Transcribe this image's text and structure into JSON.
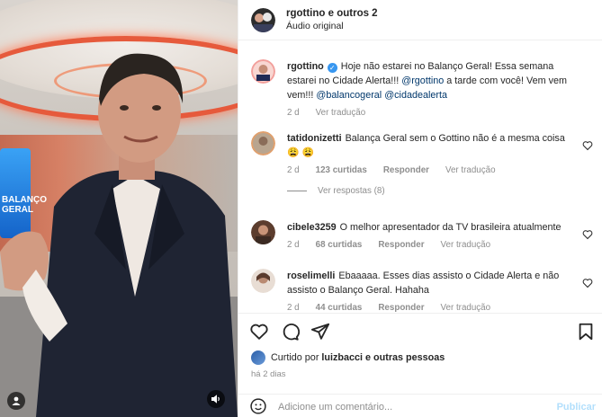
{
  "video": {
    "screen_text": "BALANÇO GERAL",
    "sound_icon": "speaker-icon",
    "user_icon": "user-tag-icon"
  },
  "header": {
    "title": "rgottino e outros 2",
    "subtitle": "Áudio original"
  },
  "comments": [
    {
      "username": "rgottino",
      "verified": true,
      "text_before": "Hoje não estarei no Balanço Geral! Essa semana estarei no Cidade Alerta!!! ",
      "mention1": "@rgottino",
      "text_mid": " a tarde com você! Vem vem vem!!! ",
      "mention2": "@balancogeral",
      "mention3": "@cidadealerta",
      "time": "2 d",
      "translate": "Ver tradução"
    },
    {
      "username": "tatidonizetti",
      "text": "Balança Geral sem o Gottino não é a mesma coisa",
      "emoji": "😩 😩",
      "time": "2 d",
      "likes": "123 curtidas",
      "reply": "Responder",
      "translate": "Ver tradução",
      "view_replies": "Ver respostas (8)"
    },
    {
      "username": "cibele3259",
      "text": "O melhor apresentador da TV brasileira atualmente",
      "time": "2 d",
      "likes": "68 curtidas",
      "reply": "Responder",
      "translate": "Ver tradução"
    },
    {
      "username": "roselimelli",
      "text": "Ebaaaaa. Esses dias assisto o Cidade Alerta e não assisto o Balanço Geral. Hahaha",
      "time": "2 d",
      "likes": "44 curtidas",
      "reply": "Responder",
      "translate": "Ver tradução"
    }
  ],
  "likes_line": {
    "prefix": "Curtido por",
    "user": "luizbacci",
    "connector": "e",
    "others": "outras pessoas"
  },
  "date": "há 2 dias",
  "add_comment": {
    "placeholder": "Adicione um comentário...",
    "publish": "Publicar"
  },
  "colors": {
    "mention": "#00376b",
    "meta": "#8e8e8e",
    "publish": "#b2dffc",
    "verified": "#3897f0"
  }
}
